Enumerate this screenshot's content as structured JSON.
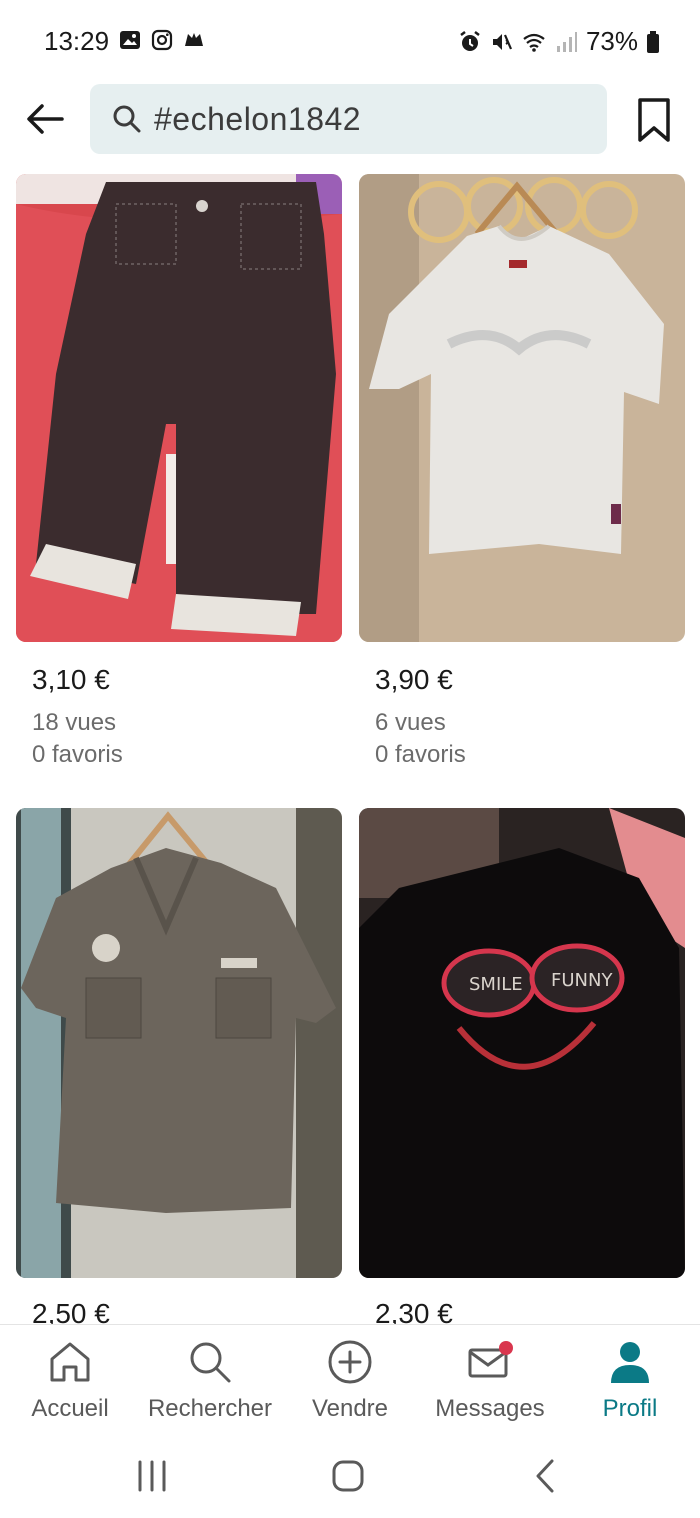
{
  "status": {
    "time": "13:29",
    "battery": "73%"
  },
  "search": {
    "query": "#echelon1842"
  },
  "items": [
    {
      "price": "3,10 €",
      "views": "18 vues",
      "favorites": "0 favoris",
      "image": "dark-brown-trousers-photo"
    },
    {
      "price": "3,90 €",
      "views": "6 vues",
      "favorites": "0 favoris",
      "image": "white-tshirt-photo"
    },
    {
      "price": "2,50 €",
      "views": "",
      "favorites": "",
      "image": "grey-shirt-photo"
    },
    {
      "price": "2,30 €",
      "views": "",
      "favorites": "",
      "image": "black-smile-funny-top-photo"
    }
  ],
  "nav": {
    "items": [
      {
        "label": "Accueil",
        "icon": "home-icon"
      },
      {
        "label": "Rechercher",
        "icon": "search-icon"
      },
      {
        "label": "Vendre",
        "icon": "plus-circle-icon"
      },
      {
        "label": "Messages",
        "icon": "mail-icon"
      },
      {
        "label": "Profil",
        "icon": "person-icon"
      }
    ],
    "active": "Profil"
  },
  "colors": {
    "accent": "#0b7a86",
    "search_bg": "#e6eff0",
    "notification_dot": "#d9364e"
  }
}
